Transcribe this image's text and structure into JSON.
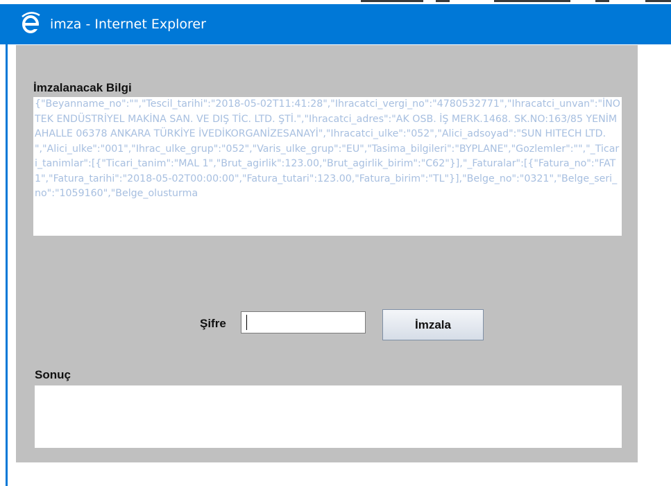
{
  "window": {
    "title": "imza - Internet Explorer",
    "icon": "internet-explorer-icon",
    "titlebar_color": "#0078d7"
  },
  "form": {
    "data_label": "İmzalanacak Bilgi",
    "data_text": "{\"Beyanname_no\":\"\",\"Tescil_tarihi\":\"2018-05-02T11:41:28\",\"Ihracatci_vergi_no\":\"4780532771\",\"Ihracatci_unvan\":\"İNOTEK ENDÜSTRİYEL MAKİNA SAN. VE DIŞ TİC. LTD. ŞTİ.\",\"Ihracatci_adres\":\"AK OSB. İŞ MERK.1468. SK.NO:163/85  YENİMAHALLE 06378 ANKARA TÜRKİYE İVEDİKORGANİZESANAYİ\",\"Ihracatci_ulke\":\"052\",\"Alici_adsoyad\":\"SUN HITECH LTD. \",\"Alici_ulke\":\"001\",\"Ihrac_ulke_grup\":\"052\",\"Varis_ulke_grup\":\"EU\",\"Tasima_bilgileri\":\"BYPLANE\",\"Gozlemler\":\"\",\"_Ticari_tanimlar\":[{\"Ticari_tanim\":\"MAL 1\",\"Brut_agirlik\":123.00,\"Brut_agirlik_birim\":\"C62\"}],\"_Faturalar\":[{\"Fatura_no\":\"FAT1\",\"Fatura_tarihi\":\"2018-05-02T00:00:00\",\"Fatura_tutari\":123.00,\"Fatura_birim\":\"TL\"}],\"Belge_no\":\"0321\",\"Belge_seri_no\":\"1059160\",\"Belge_olusturma",
    "password_label": "Şifre",
    "password_value": "",
    "sign_button_label": "İmzala",
    "result_label": "Sonuç",
    "result_text": "",
    "panel_color": "#c0c0c0",
    "data_text_color": "#a7bfe0"
  }
}
